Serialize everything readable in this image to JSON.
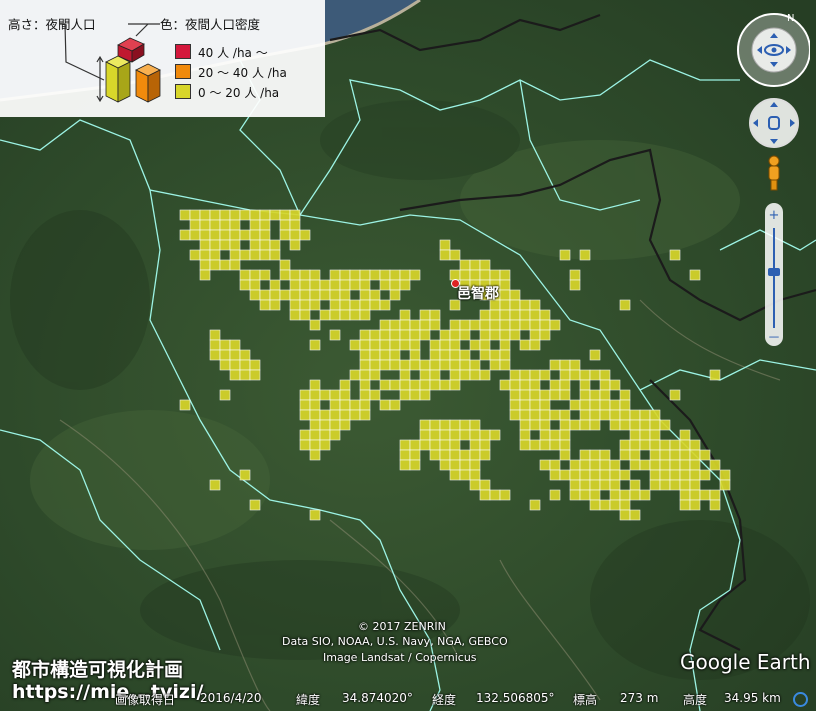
{
  "legend": {
    "height_label": "高さ：夜間人口",
    "color_label": "色：夜間人口密度",
    "classes": [
      {
        "label": "40 人 /ha ～",
        "color": "#d4183c"
      },
      {
        "label": "20 ～ 40 人 /ha",
        "color": "#f08a0c"
      },
      {
        "label": "0 ～ 20 人 /ha",
        "color": "#d8d62a"
      }
    ]
  },
  "map": {
    "place_label": "邑智郡",
    "copyright_line1": "© 2017 ZENRIN",
    "copyright_line2": "Data SIO, NOAA, U.S. Navy, NGA, GEBCO",
    "copyright_line3": "Image Landsat / Copernicus",
    "mesh_color": "#d8d62a",
    "boundary_color": "#9cf3e4"
  },
  "branding": {
    "site_title": "都市構造可視化計画",
    "site_url": "https://mie...tvizi/",
    "google_earth": "Google Earth"
  },
  "status_bar": {
    "date_label": "画像取得日",
    "date": "2016/4/20",
    "lat_label": "緯度",
    "lat": "34.874020°",
    "lon_label": "経度",
    "lon": "132.506805°",
    "elev_label": "標高",
    "elev": "273 m",
    "alt_label": "高度",
    "alt": "34.95 km"
  },
  "controls": {
    "look_icon": "eye-icon",
    "move_icon": "hand-icon",
    "streetview_icon": "pegman-icon",
    "zoom_in": "+",
    "zoom_out": "－",
    "north": "N"
  }
}
